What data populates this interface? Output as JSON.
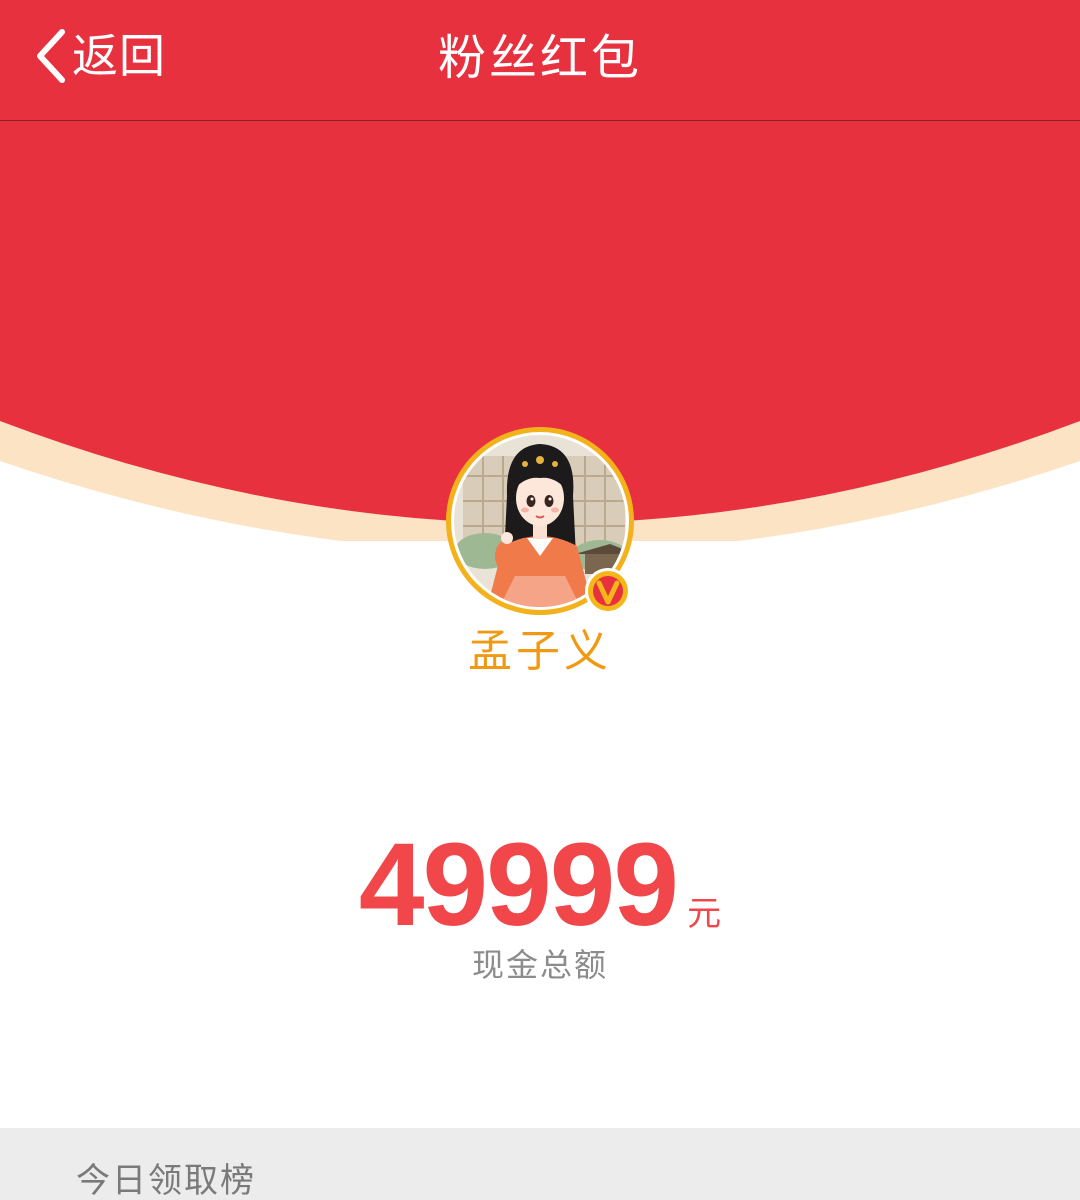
{
  "header": {
    "back_label": "返回",
    "title": "粉丝红包"
  },
  "colors": {
    "header_red": "#e8313f",
    "envelope_red": "#e8313f",
    "envelope_rim": "#fbe3c3",
    "name_orange": "#f09a14",
    "amount_red": "#f2474a",
    "caption_gray": "#8c8c8c",
    "section_gray": "#ececec"
  },
  "sender": {
    "name": "孟子义",
    "avatar": "avatar-illustration",
    "verified_icon": "verified-v-icon"
  },
  "amount": {
    "value": "49999",
    "unit": "元",
    "caption": "现金总额"
  },
  "leaderboard": {
    "title": "今日领取榜"
  }
}
